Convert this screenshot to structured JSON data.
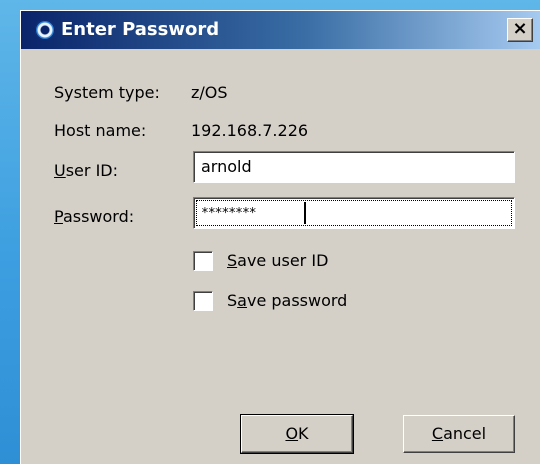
{
  "window": {
    "title": "Enter Password",
    "close_glyph": "×"
  },
  "info": {
    "system_type_label": "System type:",
    "system_type_value": "z/OS",
    "host_name_label": "Host name:",
    "host_name_value": "192.168.7.226"
  },
  "fields": {
    "user_id_label_ul": "U",
    "user_id_label_rest": "ser ID:",
    "user_id_value": "arnold",
    "password_label_ul": "P",
    "password_label_rest": "assword:",
    "password_value": "********"
  },
  "options": {
    "save_user_id_ul": "S",
    "save_user_id_rest": "ave user ID",
    "save_user_id_checked": false,
    "save_password_pre": "S",
    "save_password_ul": "a",
    "save_password_rest": "ve password",
    "save_password_checked": false
  },
  "buttons": {
    "ok_ul": "O",
    "ok_rest": "K",
    "cancel_ul": "C",
    "cancel_rest": "ancel"
  },
  "icons": {
    "title": "app-globe-icon",
    "close": "close-icon",
    "checkbox": "checkbox-icon"
  }
}
